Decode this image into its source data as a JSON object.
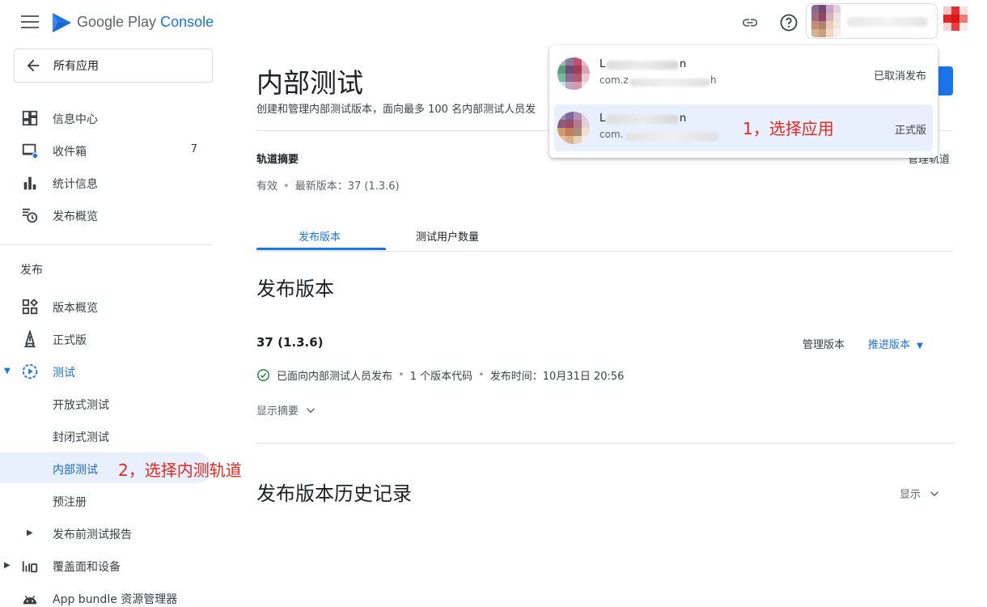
{
  "header": {
    "brand_prefix": "Google Play",
    "brand_accent": "Console",
    "link_icon": "link-icon",
    "help_icon": "help-icon",
    "account_name": "l..........m"
  },
  "sidebar": {
    "back_label": "所有应用",
    "items": [
      {
        "label": "信息中心",
        "icon": "dashboard-icon"
      },
      {
        "label": "收件箱",
        "icon": "inbox-icon",
        "count": "7"
      },
      {
        "label": "统计信息",
        "icon": "bar-chart-icon"
      },
      {
        "label": "发布概览",
        "icon": "publishing-overview-icon"
      }
    ],
    "section_heading": "发布",
    "release_items": [
      {
        "label": "版本概览",
        "icon": "releases-overview-icon"
      },
      {
        "label": "正式版",
        "icon": "production-icon"
      },
      {
        "label": "测试",
        "icon": "testing-icon"
      }
    ],
    "testing_sub": [
      "开放式测试",
      "封闭式测试",
      "内部测试"
    ],
    "more_items": [
      {
        "label": "预注册"
      },
      {
        "label": "发布前测试报告"
      },
      {
        "label": "覆盖面和设备"
      },
      {
        "label": "App bundle 资源管理器"
      }
    ]
  },
  "annotations": {
    "select_app": "1，选择应用",
    "select_track": "2，选择内测轨道"
  },
  "main": {
    "title": "内部测试",
    "subtitle": "创建和管理内部测试版本，面向最多 100 名内部测试人员发",
    "track_summary_heading": "轨道摘要",
    "manage_track_link": "管理轨道",
    "summary_status": "有效",
    "summary_latest": "最新版本：37 (1.3.6)",
    "tabs": [
      "发布版本",
      "测试用户数量"
    ],
    "releases_heading": "发布版本",
    "release": {
      "name": "37 (1.3.6)",
      "manage_label": "管理版本",
      "promote_label": "推进版本",
      "status_text": "已面向内部测试人员发布",
      "codes_text": "1 个版本代码",
      "release_time": "发布时间：10月31日 20:56",
      "show_summary": "显示摘要"
    },
    "history_heading": "发布版本历史记录",
    "history_show": "显示"
  },
  "app_dropdown": {
    "items": [
      {
        "name_initial": "L",
        "name_suffix": "n",
        "package_prefix": "com.z",
        "package_suffix": "h",
        "status": "已取消发布",
        "selected": false
      },
      {
        "name_initial": "L",
        "name_suffix": "n",
        "package_prefix": "com.",
        "package_suffix": "",
        "status": "正式版",
        "selected": true
      }
    ]
  },
  "colors": {
    "accent": "#1a73e8",
    "annotation_red": "#e8261c",
    "selected_bg": "#e8f0fe",
    "success_green": "#188038"
  }
}
